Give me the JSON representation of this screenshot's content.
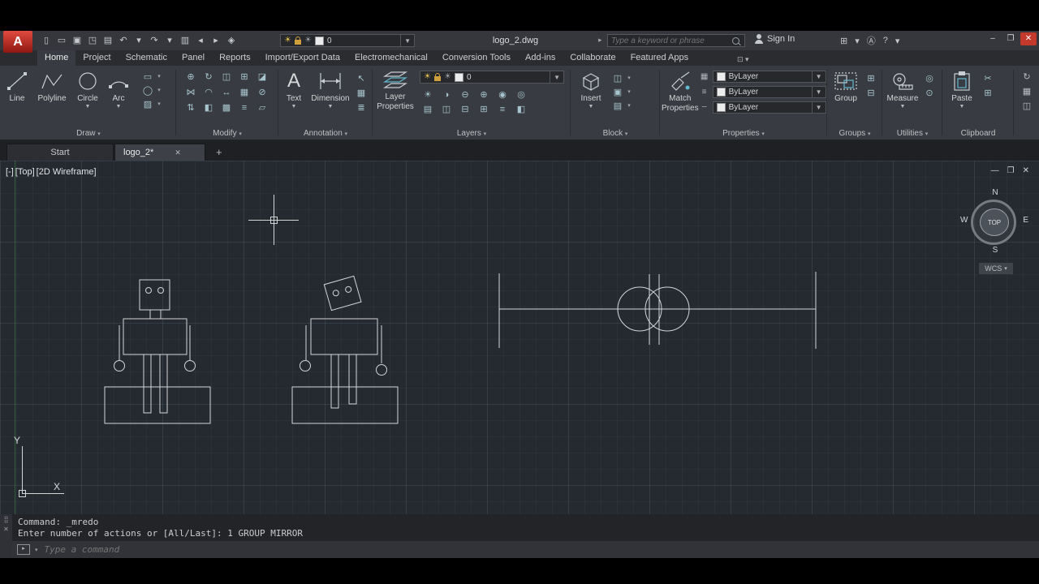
{
  "titlebar": {
    "app_button": "A",
    "filename": "logo_2.dwg",
    "search_placeholder": "Type a keyword or phrase",
    "signin_label": "Sign In",
    "layer_value": "0",
    "qat": [
      {
        "name": "new-file-icon",
        "glyph": "▯"
      },
      {
        "name": "open-folder-icon",
        "glyph": "▭"
      },
      {
        "name": "save-icon",
        "glyph": "▣"
      },
      {
        "name": "save-as-icon",
        "glyph": "◳"
      },
      {
        "name": "plot-icon",
        "glyph": "▤"
      },
      {
        "name": "undo-icon",
        "glyph": "↶"
      },
      {
        "name": "undo-caret-icon",
        "glyph": "▾"
      },
      {
        "name": "redo-icon",
        "glyph": "↷"
      },
      {
        "name": "redo-caret-icon",
        "glyph": "▾"
      },
      {
        "name": "print-icon",
        "glyph": "▥"
      },
      {
        "name": "back-icon",
        "glyph": "◂"
      },
      {
        "name": "forward-icon",
        "glyph": "▸"
      },
      {
        "name": "workspace-icon",
        "glyph": "◈"
      }
    ],
    "right_icons": [
      {
        "name": "cart-icon",
        "glyph": "⊞"
      },
      {
        "name": "apps-caret-icon",
        "glyph": "▾"
      },
      {
        "name": "a360-icon",
        "glyph": "Ⓐ"
      },
      {
        "name": "help-icon",
        "glyph": "?"
      },
      {
        "name": "help-caret-icon",
        "glyph": "▾"
      }
    ],
    "window_controls": {
      "minimize": "–",
      "restore": "❐",
      "close": "✕"
    }
  },
  "ribbon_tabs": {
    "items": [
      {
        "label": "Home",
        "active": true
      },
      {
        "label": "Project"
      },
      {
        "label": "Schematic"
      },
      {
        "label": "Panel"
      },
      {
        "label": "Reports"
      },
      {
        "label": "Import/Export Data"
      },
      {
        "label": "Electromechanical"
      },
      {
        "label": "Conversion Tools"
      },
      {
        "label": "Add-ins"
      },
      {
        "label": "Collaborate"
      },
      {
        "label": "Featured Apps"
      }
    ],
    "collapse_glyph": "⊡ ▾"
  },
  "ribbon": {
    "draw": {
      "label": "Draw",
      "line": "Line",
      "polyline": "Polyline",
      "circle": "Circle",
      "arc": "Arc",
      "small": [
        {
          "name": "rectangle-icon",
          "glyph": "▭"
        },
        {
          "name": "ellipse-icon",
          "glyph": "◯"
        },
        {
          "name": "hatch-icon",
          "glyph": "▨"
        }
      ]
    },
    "modify": {
      "label": "Modify",
      "icons": [
        {
          "name": "move-icon",
          "glyph": "⊕"
        },
        {
          "name": "rotate-icon",
          "glyph": "↻"
        },
        {
          "name": "trim-icon",
          "glyph": "◫"
        },
        {
          "name": "copy-icon",
          "glyph": "⊞"
        },
        {
          "name": "erase-icon",
          "glyph": "◪"
        },
        {
          "name": "mirror-icon",
          "glyph": "⋈"
        },
        {
          "name": "fillet-icon",
          "glyph": "◠"
        },
        {
          "name": "stretch-icon",
          "glyph": "↔"
        },
        {
          "name": "array-icon",
          "glyph": "▦"
        },
        {
          "name": "offset-icon",
          "glyph": "⊘"
        },
        {
          "name": "scale-icon",
          "glyph": "⇅"
        },
        {
          "name": "explode-icon",
          "glyph": "◧"
        },
        {
          "name": "join-icon",
          "glyph": "▩"
        },
        {
          "name": "chamfer-icon",
          "glyph": "≡"
        },
        {
          "name": "blend-icon",
          "glyph": "▱"
        }
      ]
    },
    "annotation": {
      "label": "Annotation",
      "text": "Text",
      "dimension": "Dimension",
      "small": [
        {
          "name": "leader-icon",
          "glyph": "↖"
        },
        {
          "name": "table-icon",
          "glyph": "▦"
        },
        {
          "name": "mtext-icon",
          "glyph": "≣"
        }
      ]
    },
    "layers": {
      "label": "Layers",
      "layer_properties_1": "Layer",
      "layer_properties_2": "Properties",
      "layer_value": "0",
      "row1": [
        {
          "name": "layer-on-icon",
          "glyph": "☀",
          "c": "y"
        },
        {
          "name": "layer-freeze-icon",
          "glyph": "◑",
          "c": ""
        },
        {
          "name": "layer-lock-icon",
          "glyph": "⊖",
          "c": ""
        },
        {
          "name": "layer-isolate-icon",
          "glyph": "⊕",
          "c": ""
        },
        {
          "name": "layer-color-icon",
          "glyph": "◉",
          "c": ""
        },
        {
          "name": "layer-state-icon",
          "glyph": "◎",
          "c": "g"
        }
      ],
      "row2": [
        {
          "name": "layer-current-icon",
          "glyph": "▤",
          "c": ""
        },
        {
          "name": "layer-match-icon",
          "glyph": "◫",
          "c": ""
        },
        {
          "name": "layer-prev-icon",
          "glyph": "⊟",
          "c": ""
        },
        {
          "name": "layer-walk-icon",
          "glyph": "⊞",
          "c": ""
        },
        {
          "name": "layer-off-icon",
          "glyph": "≡",
          "c": "g"
        },
        {
          "name": "layer-merge-icon",
          "glyph": "◧",
          "c": ""
        }
      ]
    },
    "block": {
      "label": "Block",
      "insert": "Insert",
      "small": [
        {
          "name": "create-block-icon",
          "glyph": "◫"
        },
        {
          "name": "edit-block-icon",
          "glyph": "▣"
        },
        {
          "name": "attributes-icon",
          "glyph": "▤"
        }
      ]
    },
    "properties": {
      "label": "Properties",
      "match_1": "Match",
      "match_2": "Properties",
      "rows": [
        {
          "name": "object-color-icon",
          "icon": "▦",
          "value": "ByLayer",
          "swatch": true
        },
        {
          "name": "lineweight-icon",
          "icon": "≡",
          "value": "ByLayer",
          "swatch": false
        },
        {
          "name": "linetype-icon",
          "icon": "┄",
          "value": "ByLayer",
          "swatch": false
        }
      ]
    },
    "groups": {
      "label": "Groups",
      "group": "Group",
      "small": [
        {
          "name": "ungroup-icon",
          "glyph": "⊞"
        },
        {
          "name": "group-edit-icon",
          "glyph": "⊟"
        }
      ]
    },
    "utilities": {
      "label": "Utilities",
      "measure": "Measure",
      "small": [
        {
          "name": "id-point-icon",
          "glyph": "◎"
        },
        {
          "name": "quick-calc-icon",
          "glyph": "⊙"
        }
      ]
    },
    "clipboard": {
      "label": "Clipboard",
      "paste": "Paste",
      "small": [
        {
          "name": "cut-icon",
          "glyph": "✂"
        },
        {
          "name": "copy-clip-icon",
          "glyph": "⊞"
        }
      ]
    },
    "edge_icons": [
      {
        "name": "sync-icon",
        "glyph": "↻"
      },
      {
        "name": "grid-tool-icon",
        "glyph": "▦"
      },
      {
        "name": "panel-tool-icon",
        "glyph": "◫"
      }
    ]
  },
  "filetabs": {
    "start": "Start",
    "active": "logo_2*",
    "close": "✕",
    "add": "+"
  },
  "viewport": {
    "controls": {
      "minus": "[-]",
      "view": "[Top]",
      "style": "[2D Wireframe]"
    },
    "win": {
      "minimize": "—",
      "restore": "❐",
      "close": "✕"
    },
    "viewcube": {
      "n": "N",
      "w": "W",
      "e": "E",
      "s": "S",
      "top": "TOP",
      "wcs": "WCS",
      "wcs_caret": "▾"
    },
    "ucs": {
      "x": "X",
      "y": "Y"
    }
  },
  "command": {
    "line1": "Command: _mredo",
    "line2": "Enter number of actions or [All/Last]: 1 GROUP MIRROR",
    "placeholder": "Type a command",
    "gutter_grip": "⣿",
    "gutter_close": "✕",
    "input_icon": "▸"
  }
}
